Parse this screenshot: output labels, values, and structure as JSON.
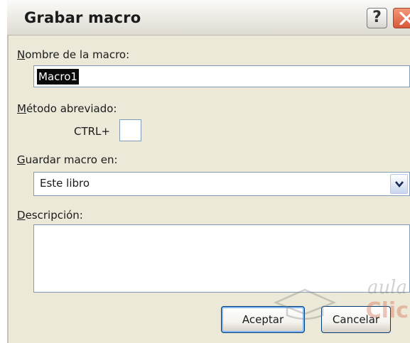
{
  "window": {
    "title": "Grabar macro",
    "help_glyph": "?"
  },
  "form": {
    "macro_name_label_prefix": "N",
    "macro_name_label_rest": "ombre de la macro:",
    "macro_name_value": "Macro1",
    "shortcut_label_prefix": "M",
    "shortcut_label_rest": "étodo abreviado:",
    "shortcut_prefix": "CTRL+",
    "shortcut_value": "",
    "store_label_prefix": "G",
    "store_label_rest": "uardar macro en:",
    "store_value": "Este libro",
    "description_label_prefix": "D",
    "description_label_rest": "escripción:",
    "description_value": ""
  },
  "buttons": {
    "ok": "Aceptar",
    "cancel": "Cancelar"
  },
  "watermark": {
    "line1": "aula",
    "line2": "Clic"
  },
  "colors": {
    "dialog_bg": "#ece9d8",
    "close_btn": "#d8573a",
    "selection_bg": "#0a0a0a",
    "input_border": "#7f9db9"
  },
  "icons": {
    "help": "question-mark-icon",
    "close": "close-x-icon",
    "dropdown": "chevron-down-icon"
  }
}
